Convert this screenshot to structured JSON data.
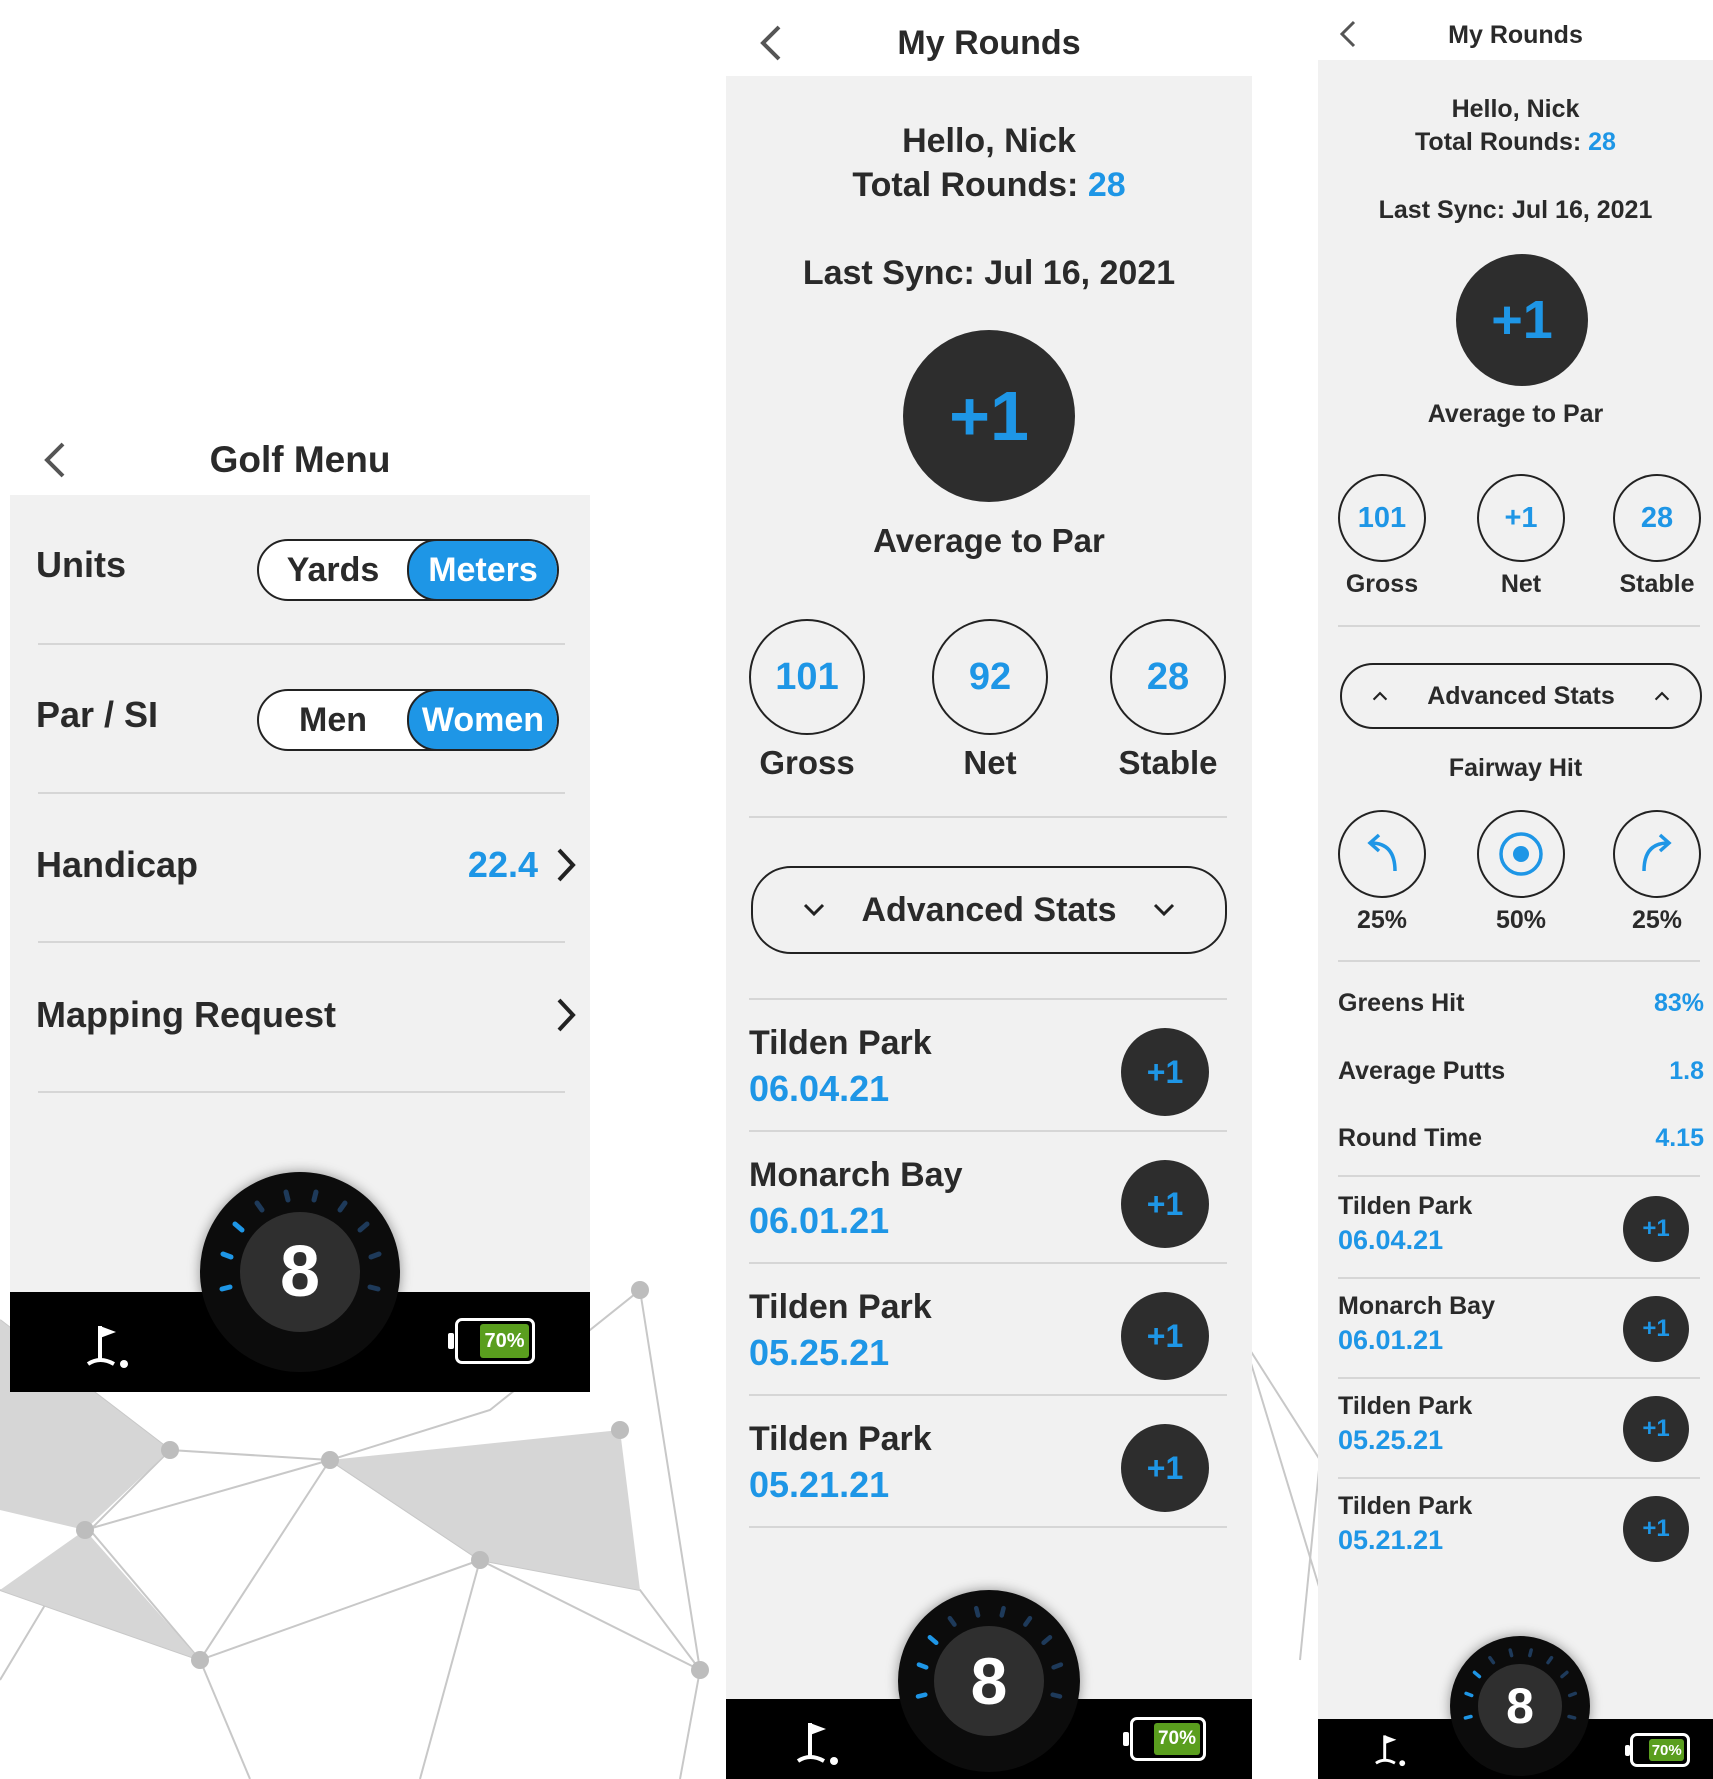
{
  "colors": {
    "accent": "#1e96e6",
    "dark": "#2d2d2d",
    "panel": "#f1f1f1",
    "battery": "#5a9e1e"
  },
  "golf_menu": {
    "title": "Golf Menu",
    "units": {
      "label": "Units",
      "options": [
        "Yards",
        "Meters"
      ],
      "selected": "Meters"
    },
    "par_si": {
      "label": "Par / SI",
      "options": [
        "Men",
        "Women"
      ],
      "selected": "Women"
    },
    "handicap": {
      "label": "Handicap",
      "value": "22.4"
    },
    "mapping": {
      "label": "Mapping Request"
    },
    "bottom": {
      "hole": "8",
      "battery": "70%",
      "flag_icon": "golf-flag-icon"
    }
  },
  "my_rounds": {
    "title": "My Rounds",
    "greeting": "Hello, Nick",
    "total_label": "Total Rounds:",
    "total_value": "28",
    "sync": "Last Sync: Jul 16, 2021",
    "avg_par": "+1",
    "avg_label": "Average to Par",
    "stats": [
      {
        "value": "101",
        "label": "Gross"
      },
      {
        "value": "92",
        "label": "Net"
      },
      {
        "value": "28",
        "label": "Stable"
      }
    ],
    "advanced": "Advanced Stats",
    "rounds": [
      {
        "name": "Tilden Park",
        "date": "06.04.21",
        "score": "+1"
      },
      {
        "name": "Monarch Bay",
        "date": "06.01.21",
        "score": "+1"
      },
      {
        "name": "Tilden Park",
        "date": "05.25.21",
        "score": "+1"
      },
      {
        "name": "Tilden Park",
        "date": "05.21.21",
        "score": "+1"
      }
    ],
    "bottom": {
      "hole": "8",
      "battery": "70%"
    }
  },
  "my_rounds_expanded": {
    "title": "My Rounds",
    "greeting": "Hello, Nick",
    "total_label": "Total Rounds:",
    "total_value": "28",
    "sync": "Last Sync: Jul 16, 2021",
    "avg_par": "+1",
    "avg_label": "Average to Par",
    "stats": [
      {
        "value": "101",
        "label": "Gross"
      },
      {
        "value": "+1",
        "label": "Net"
      },
      {
        "value": "28",
        "label": "Stable"
      }
    ],
    "advanced": "Advanced Stats",
    "fairway_label": "Fairway Hit",
    "fairway": [
      {
        "dir": "left",
        "pct": "25%"
      },
      {
        "dir": "center",
        "pct": "50%"
      },
      {
        "dir": "right",
        "pct": "25%"
      }
    ],
    "metrics": [
      {
        "label": "Greens Hit",
        "value": "83%"
      },
      {
        "label": "Average Putts",
        "value": "1.8"
      },
      {
        "label": "Round Time",
        "value": "4.15"
      }
    ],
    "rounds": [
      {
        "name": "Tilden Park",
        "date": "06.04.21",
        "score": "+1"
      },
      {
        "name": "Monarch Bay",
        "date": "06.01.21",
        "score": "+1"
      },
      {
        "name": "Tilden Park",
        "date": "05.25.21",
        "score": "+1"
      },
      {
        "name": "Tilden Park",
        "date": "05.21.21",
        "score": "+1"
      }
    ],
    "bottom": {
      "hole": "8",
      "battery": "70%"
    }
  }
}
